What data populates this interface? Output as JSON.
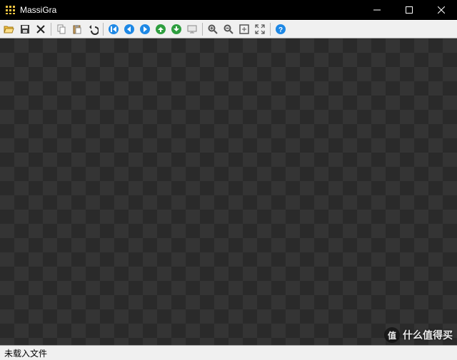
{
  "titlebar": {
    "app_name": "MassiGra"
  },
  "toolbar": {
    "open": "Open",
    "save": "Save",
    "delete": "Delete",
    "copy": "Copy",
    "paste": "Paste",
    "undo": "Undo",
    "first": "First",
    "prev": "Previous",
    "next": "Next",
    "up": "Up folder",
    "down": "Down folder",
    "slideshow": "Slideshow",
    "zoom_in": "Zoom In",
    "zoom_out": "Zoom Out",
    "fit": "Fit Window",
    "actual": "Actual Size",
    "help": "Help"
  },
  "status": {
    "text": "未载入文件"
  },
  "watermark": {
    "badge": "值",
    "text": "什么值得买"
  }
}
